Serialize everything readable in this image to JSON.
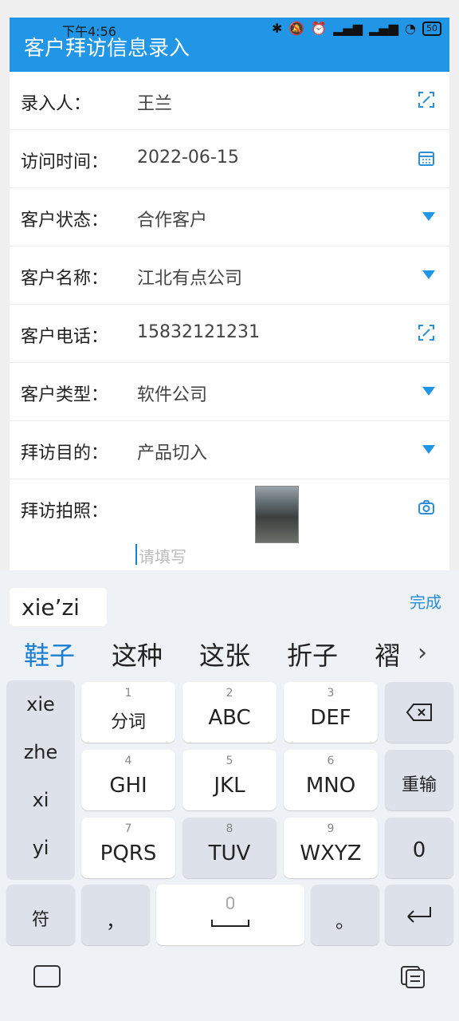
{
  "status_bar": {
    "time": "下午4:56",
    "battery": "50"
  },
  "app_bar": {
    "title": "客户拜访信息录入"
  },
  "form": {
    "rows": [
      {
        "label": "录入人：",
        "value": "王兰",
        "icon": "scan-icon"
      },
      {
        "label": "访问时间：",
        "value": "2022-06-15",
        "icon": "calendar-icon"
      },
      {
        "label": "客户状态：",
        "value": "合作客户",
        "icon": "dropdown-caret-icon"
      },
      {
        "label": "客户名称：",
        "value": "江北有点公司",
        "icon": "dropdown-caret-icon"
      },
      {
        "label": "客户电话：",
        "value": "15832121231",
        "icon": "scan-icon"
      },
      {
        "label": "客户类型：",
        "value": "软件公司",
        "icon": "dropdown-caret-icon"
      },
      {
        "label": "拜访目的：",
        "value": "产品切入",
        "icon": "dropdown-caret-icon"
      },
      {
        "label": "拜访拍照：",
        "value": "",
        "icon": "camera-icon"
      }
    ],
    "note_placeholder": "请填写"
  },
  "ime": {
    "pinyin": "xie’zi",
    "done_label": "完成",
    "candidates": [
      "鞋子",
      "这种",
      "这张",
      "折子",
      "褶"
    ],
    "left_col": [
      "xie",
      "zhe",
      "xi",
      "yi"
    ],
    "keys": {
      "k1": {
        "num": "1",
        "label": "分词"
      },
      "k2": {
        "num": "2",
        "label": "ABC"
      },
      "k3": {
        "num": "3",
        "label": "DEF"
      },
      "k4": {
        "num": "4",
        "label": "GHI"
      },
      "k5": {
        "num": "5",
        "label": "JKL"
      },
      "k6": {
        "num": "6",
        "label": "MNO"
      },
      "k7": {
        "num": "7",
        "label": "PQRS"
      },
      "k8": {
        "num": "8",
        "label": "TUV"
      },
      "k9": {
        "num": "9",
        "label": "WXYZ"
      },
      "reenter": "重输",
      "zero": "0",
      "symbols": "符",
      "comma": "，",
      "period": "。"
    }
  },
  "colors": {
    "accent": "#2196e6",
    "link": "#1a7fd0"
  }
}
